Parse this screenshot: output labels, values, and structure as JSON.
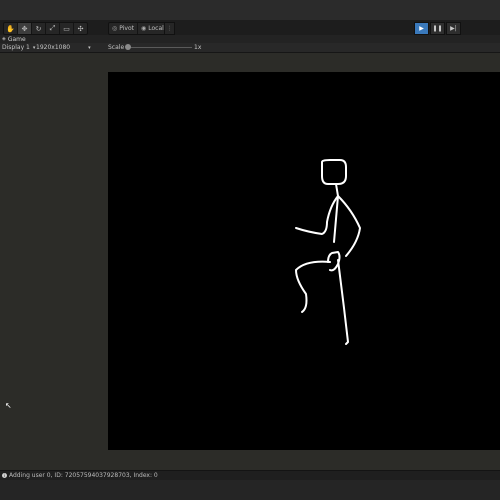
{
  "toolbar": {
    "tools": [
      {
        "icon": "hand-icon",
        "glyph": "✋",
        "active": false
      },
      {
        "icon": "move-icon",
        "glyph": "✥",
        "active": true
      },
      {
        "icon": "rotate-icon",
        "glyph": "↻",
        "active": false
      },
      {
        "icon": "scale-icon",
        "glyph": "⤢",
        "active": false
      },
      {
        "icon": "rect-tool-icon",
        "glyph": "▭",
        "active": false
      },
      {
        "icon": "transform-icon",
        "glyph": "✣",
        "active": false
      }
    ],
    "pivot_label": "Pivot",
    "local_label": "Local",
    "extra_glyph": "⋮",
    "play_glyph": "▶",
    "pause_glyph": "❚❚",
    "step_glyph": "▶|"
  },
  "tab": {
    "label": "Game",
    "icon": "game-controller-icon"
  },
  "controls": {
    "display": "Display 1",
    "resolution": "1920x1080",
    "scale_label": "Scale",
    "scale_value": "1x"
  },
  "status": {
    "message": "Adding user 0, ID: 72057594037928703, Index: 0"
  },
  "colors": {
    "play_active": "#3a79bb",
    "viewport": "#000000",
    "stick_figure": "#ffffff"
  }
}
